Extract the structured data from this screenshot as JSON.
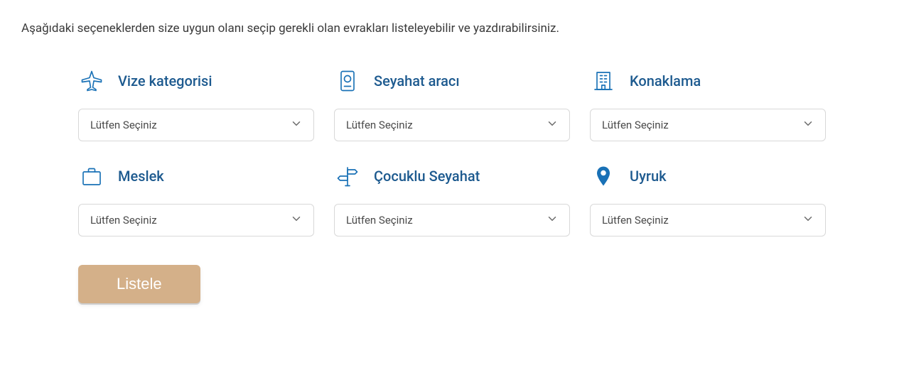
{
  "intro": "Aşağıdaki seçeneklerden size uygun olanı seçip gerekli olan evrakları listeleyebilir ve yazdırabilirsiniz.",
  "fields": {
    "visa_category": {
      "label": "Vize kategorisi",
      "placeholder": "Lütfen Seçiniz"
    },
    "travel_vehicle": {
      "label": "Seyahat aracı",
      "placeholder": "Lütfen Seçiniz"
    },
    "accommodation": {
      "label": "Konaklama",
      "placeholder": "Lütfen Seçiniz"
    },
    "profession": {
      "label": "Meslek",
      "placeholder": "Lütfen Seçiniz"
    },
    "child_travel": {
      "label": "Çocuklu Seyahat",
      "placeholder": "Lütfen Seçiniz"
    },
    "nationality": {
      "label": "Uyruk",
      "placeholder": "Lütfen Seçiniz"
    }
  },
  "submit_label": "Listele"
}
